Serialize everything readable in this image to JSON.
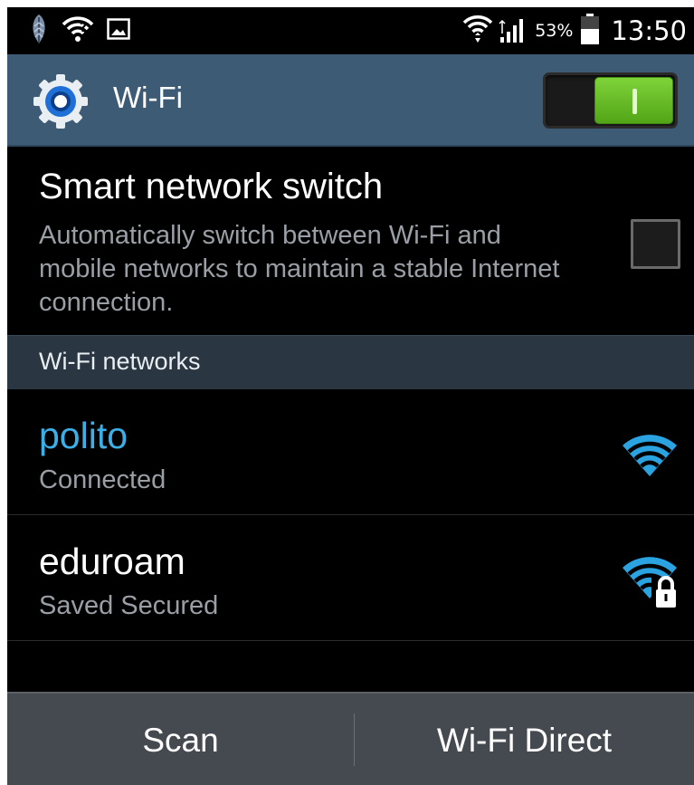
{
  "status_bar": {
    "notification_icons": [
      "feather-icon",
      "wifi-question-icon",
      "picture-icon"
    ],
    "status_icons": [
      "wifi-signal-icon",
      "cell-signal-icon",
      "battery-icon"
    ],
    "battery_percent": "53%",
    "time": "13:50"
  },
  "action_bar": {
    "icon": "gear-icon",
    "title": "Wi-Fi",
    "wifi_enabled": true,
    "accent_color": "#52a516"
  },
  "smart_switch": {
    "title": "Smart network switch",
    "description": "Automatically switch between Wi-Fi and mobile networks to maintain a stable Internet connection.",
    "checked": false
  },
  "section": {
    "label": "Wi-Fi networks"
  },
  "networks": [
    {
      "name": "polito",
      "status": "Connected",
      "name_color": "#3cb0e6",
      "icon": "wifi-signal-full-icon",
      "secured": false
    },
    {
      "name": "eduroam",
      "status": "Saved Secured",
      "name_color": "#ffffff",
      "icon": "wifi-signal-locked-icon",
      "secured": true
    }
  ],
  "bottom_bar": {
    "scan_label": "Scan",
    "direct_label": "Wi-Fi Direct"
  }
}
